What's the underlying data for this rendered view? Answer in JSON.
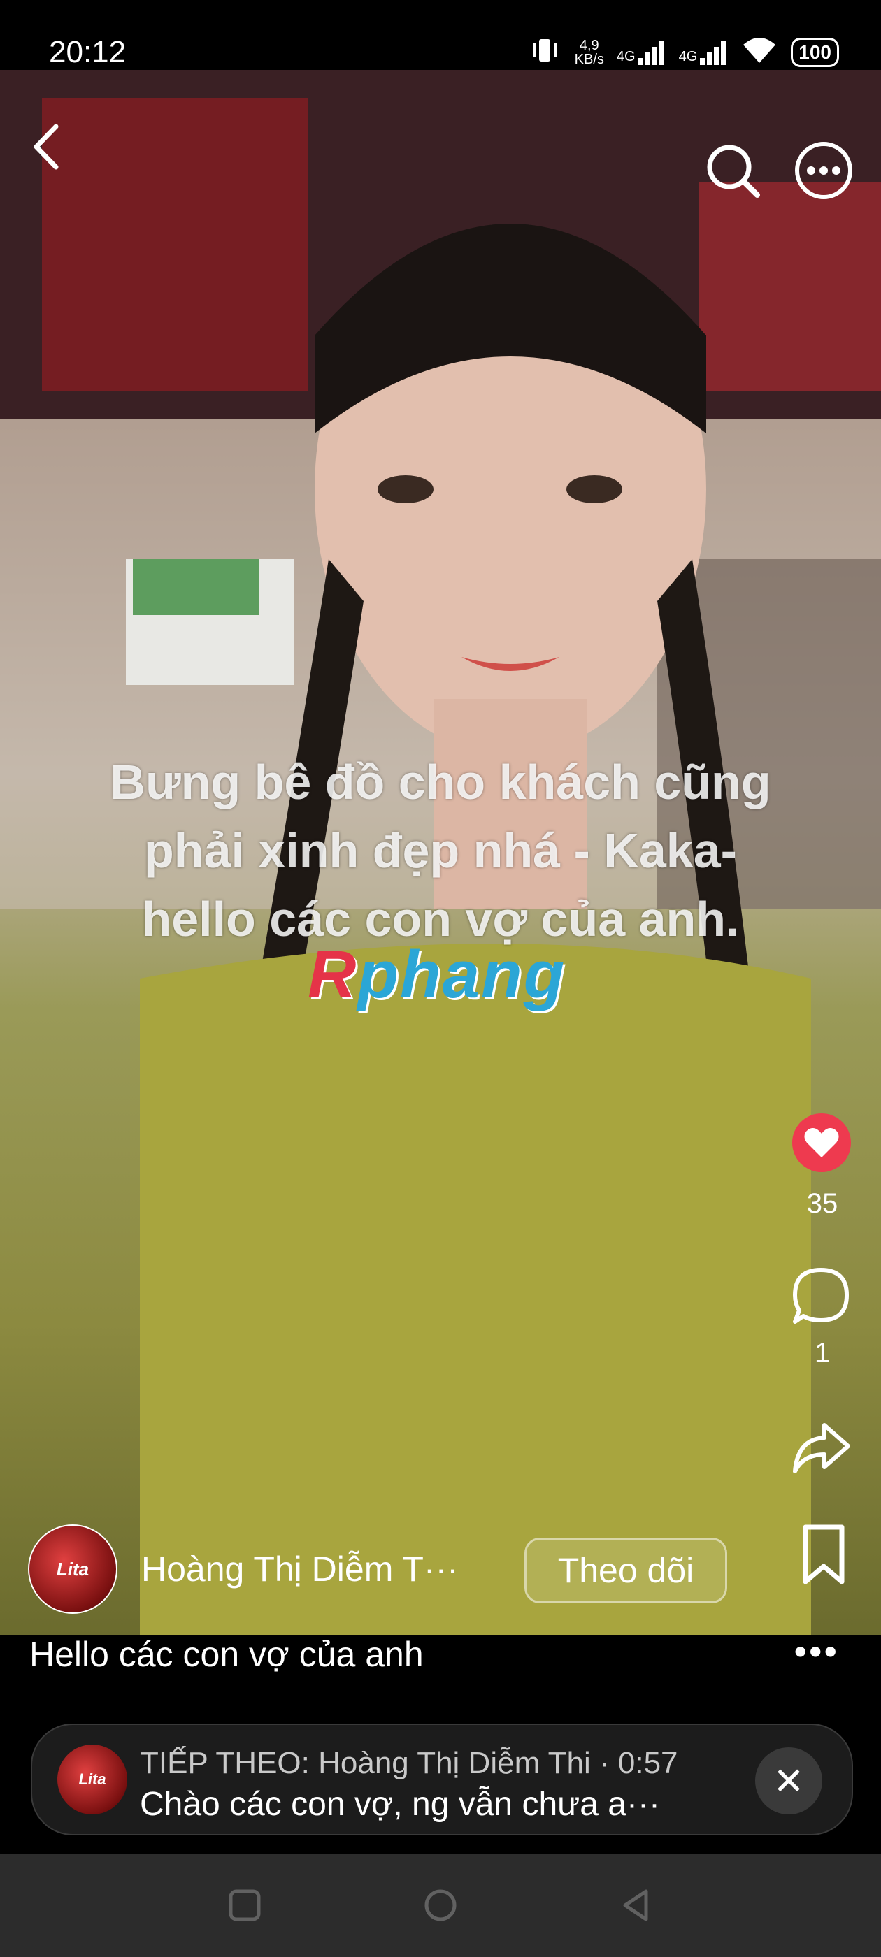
{
  "status_bar": {
    "time": "20:12",
    "net_speed_value": "4,9",
    "net_speed_unit": "KB/s",
    "network_1": "4G",
    "network_2": "4G",
    "battery": "100"
  },
  "video": {
    "caption_lines": [
      "Bưng bê đồ cho khách cũng",
      "phải xinh đẹp nhá - Kaka-",
      "hello các con vợ của anh."
    ],
    "watermark_first": "R",
    "watermark_rest": "phang"
  },
  "top_bar": {
    "back_icon": "chevron-left-icon",
    "search_icon": "search-icon",
    "more_icon": "more-horizontal-icon"
  },
  "side_actions": {
    "like_count": "35",
    "comment_count": "1",
    "like_color": "#ee3a4f"
  },
  "author": {
    "avatar_text": "Lita",
    "name": "Hoàng Thị Diễm T···",
    "follow_label": "Theo dõi"
  },
  "description": "Hello các con vợ của anh",
  "more_label": "•••",
  "next_up": {
    "avatar_text": "Lita",
    "line1": "TIẾP THEO: Hoàng Thị Diễm Thi · 0:57",
    "line2": "Chào các con vợ, ng vẫn chưa a···",
    "close_label": "✕"
  }
}
